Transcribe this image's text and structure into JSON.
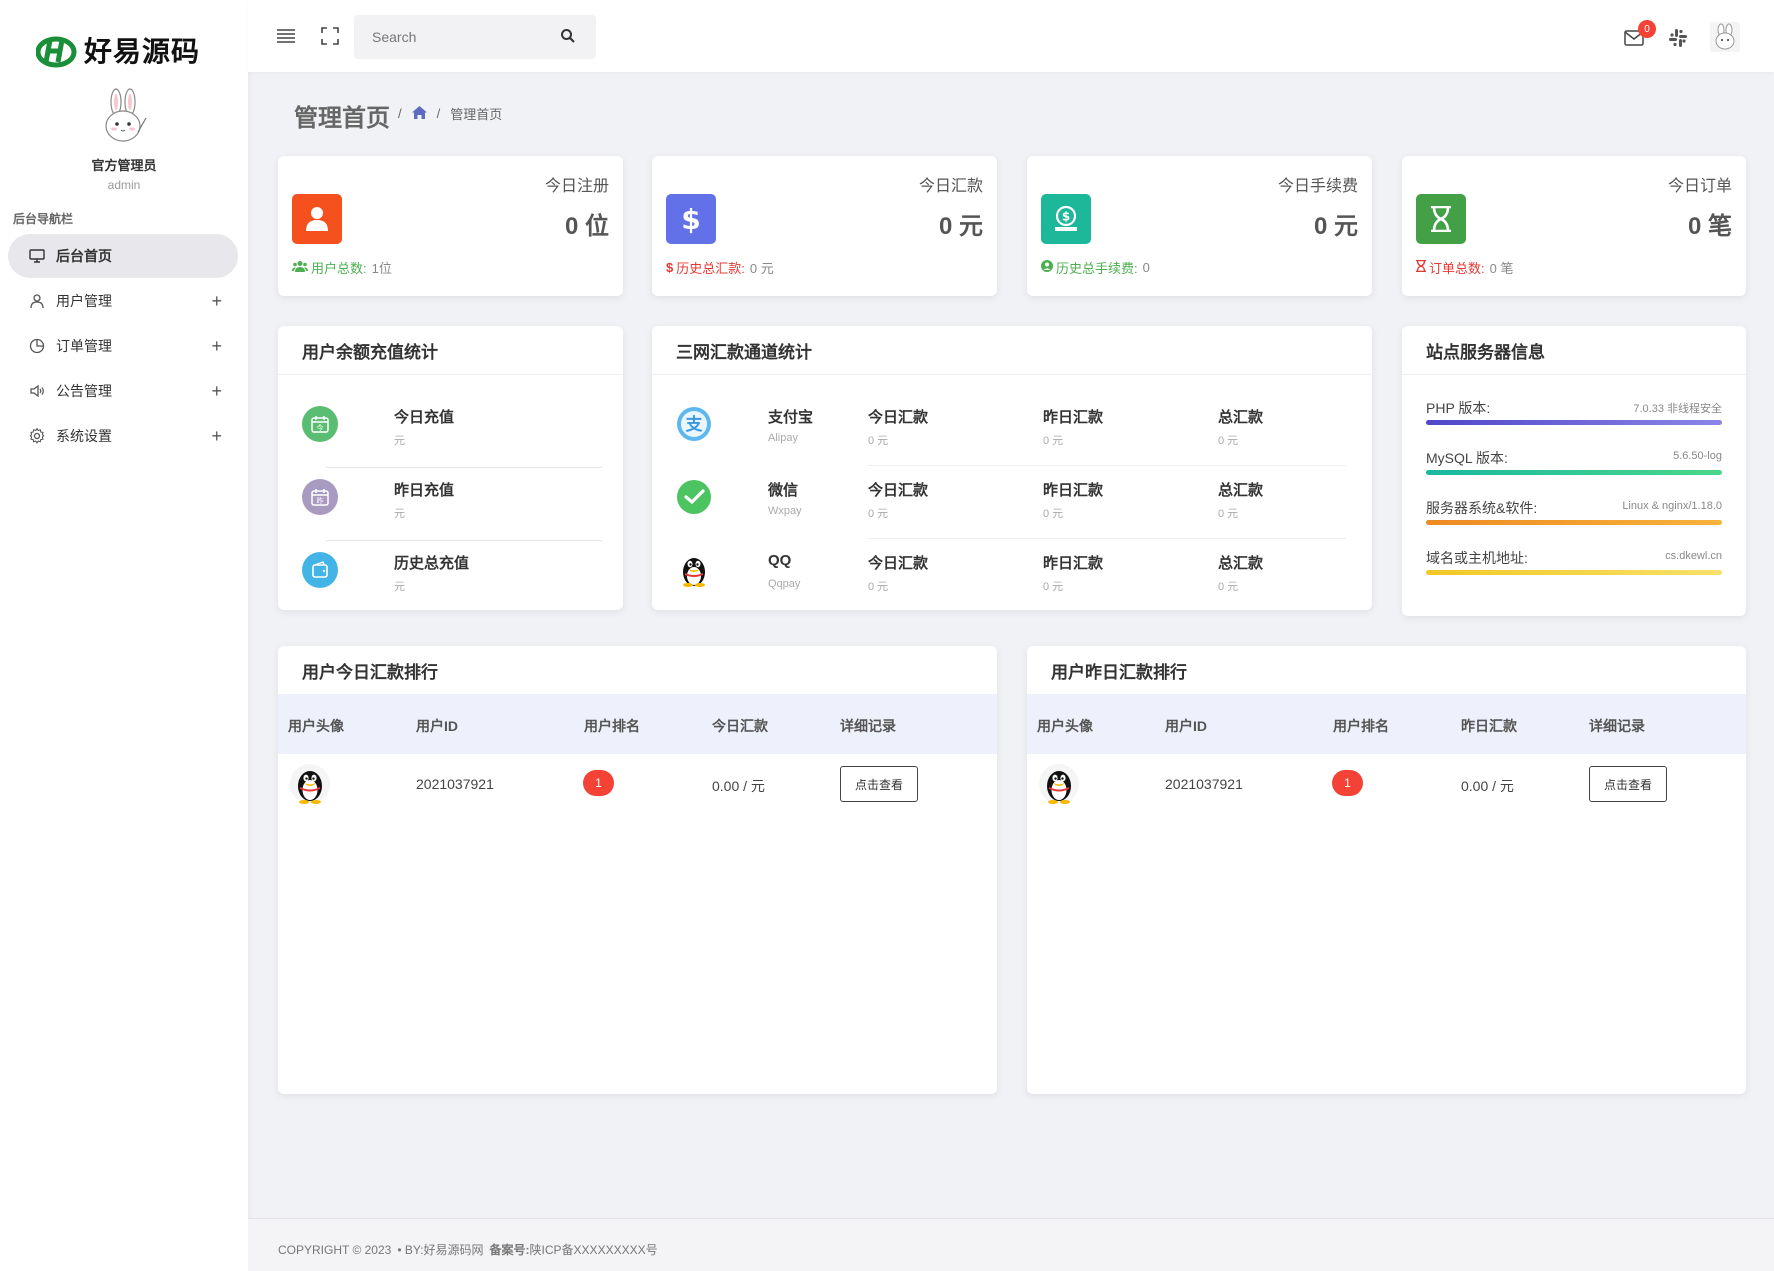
{
  "brand": {
    "name": "好易源码"
  },
  "profile": {
    "name": "官方管理员",
    "role": "admin"
  },
  "sidebar": {
    "heading": "后台导航栏",
    "items": [
      {
        "label": "后台首页",
        "icon": "monitor-icon",
        "active": true
      },
      {
        "label": "用户管理",
        "icon": "user-icon",
        "expandable": true
      },
      {
        "label": "订单管理",
        "icon": "pie-chart-icon",
        "expandable": true
      },
      {
        "label": "公告管理",
        "icon": "speaker-icon",
        "expandable": true
      },
      {
        "label": "系统设置",
        "icon": "gear-icon",
        "expandable": true
      }
    ],
    "plus": "+"
  },
  "topbar": {
    "search_placeholder": "Search",
    "mail_badge": "0"
  },
  "page": {
    "title": "管理首页",
    "breadcrumb_current": "管理首页",
    "separator": "/"
  },
  "stats": [
    {
      "title": "今日注册",
      "value": "0 位",
      "foot_label": "用户总数:",
      "foot_value": "1位",
      "color": "#f4511e",
      "foot_color": "#4caf50",
      "icon": "user-icon"
    },
    {
      "title": "今日汇款",
      "value": "0 元",
      "foot_label": "历史总汇款:",
      "foot_value": "0 元",
      "color": "#6371e8",
      "foot_color": "#e53935",
      "icon": "dollar-icon"
    },
    {
      "title": "今日手续费",
      "value": "0 元",
      "foot_label": "历史总手续费:",
      "foot_value": "0",
      "color": "#1db79a",
      "foot_color": "#4caf50",
      "icon": "money-bag-icon"
    },
    {
      "title": "今日订单",
      "value": "0 笔",
      "foot_label": "订单总数:",
      "foot_value": "0 笔",
      "color": "#43a047",
      "foot_color": "#e53935",
      "icon": "hourglass-icon"
    }
  ],
  "recharge": {
    "title": "用户余额充值统计",
    "rows": [
      {
        "label": "今日充值",
        "unit": "元",
        "color": "#5bbd72"
      },
      {
        "label": "昨日充值",
        "unit": "元",
        "color": "#a99bbf"
      },
      {
        "label": "历史总充值",
        "unit": "元",
        "color": "#42b4e6"
      }
    ]
  },
  "channels": {
    "title": "三网汇款通道统计",
    "rows": [
      {
        "name": "支付宝",
        "code": "Alipay",
        "today": "今日汇款",
        "today_v": "0 元",
        "yest": "昨日汇款",
        "yest_v": "0 元",
        "total": "总汇款",
        "total_v": "0 元"
      },
      {
        "name": "微信",
        "code": "Wxpay",
        "today": "今日汇款",
        "today_v": "0 元",
        "yest": "昨日汇款",
        "yest_v": "0 元",
        "total": "总汇款",
        "total_v": "0 元"
      },
      {
        "name": "QQ",
        "code": "Qqpay",
        "today": "今日汇款",
        "today_v": "0 元",
        "yest": "昨日汇款",
        "yest_v": "0 元",
        "total": "总汇款",
        "total_v": "0 元"
      }
    ]
  },
  "server": {
    "title": "站点服务器信息",
    "rows": [
      {
        "label": "PHP 版本:",
        "value": "7.0.33 非线程安全",
        "color": "#6a64d8"
      },
      {
        "label": "MySQL 版本:",
        "value": "5.6.50-log",
        "color": "#2fc49e"
      },
      {
        "label": "服务器系统&软件:",
        "value": "Linux & nginx/1.18.0",
        "color": "#f0a030"
      },
      {
        "label": "域名或主机地址:",
        "value": "cs.dkewl.cn",
        "color": "#f5d63a"
      }
    ]
  },
  "rank_today": {
    "title": "用户今日汇款排行",
    "headers": [
      "用户头像",
      "用户ID",
      "用户排名",
      "今日汇款",
      "详细记录"
    ],
    "row": {
      "id": "2021037921",
      "rank": "1",
      "amount": "0.00 / 元",
      "button": "点击查看"
    }
  },
  "rank_yesterday": {
    "title": "用户昨日汇款排行",
    "headers": [
      "用户头像",
      "用户ID",
      "用户排名",
      "昨日汇款",
      "详细记录"
    ],
    "row": {
      "id": "2021037921",
      "rank": "1",
      "amount": "0.00 / 元",
      "button": "点击查看"
    }
  },
  "footer": {
    "copyright": "COPYRIGHT © 2023",
    "by": "• BY:好易源码网",
    "icp_label": "备案号:",
    "icp_value": "陕ICP备XXXXXXXXX号"
  }
}
